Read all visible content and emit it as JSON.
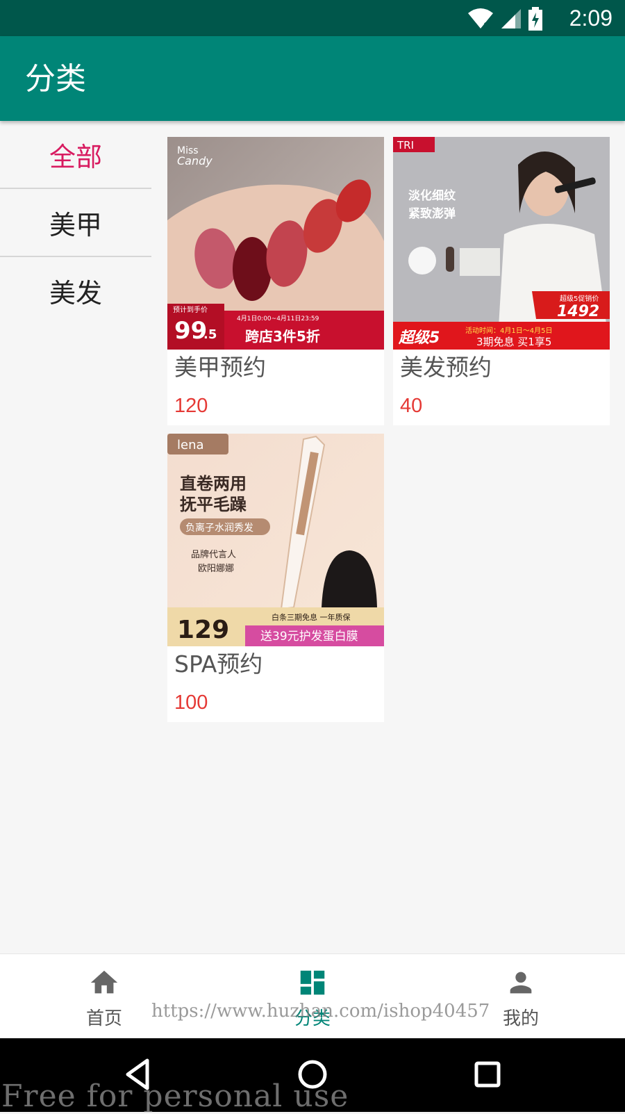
{
  "status_bar": {
    "time": "2:09",
    "icons": [
      "wifi-icon",
      "signal-icon",
      "battery-charging-icon"
    ]
  },
  "app_bar": {
    "title": "分类"
  },
  "side_menu": {
    "items": [
      {
        "label": "全部",
        "active": true
      },
      {
        "label": "美甲",
        "active": false
      },
      {
        "label": "美发",
        "active": false
      }
    ]
  },
  "products": [
    {
      "name": "美甲预约",
      "price": "120",
      "image": {
        "brand_line1": "Miss",
        "brand_line2": "Candy",
        "price_tag": "预计到手价",
        "price_big": "99",
        "price_small": ".5",
        "date_range": "4月1日0:00~4月11日23:59",
        "promo": "跨店3件5折"
      }
    },
    {
      "name": "美发预约",
      "price": "40",
      "image": {
        "brand": "TRI",
        "slogan_line1": "淡化细纹",
        "slogan_line2": "紧致澎弹",
        "promo_label": "超级5促销价",
        "promo_price": "1492",
        "event": "超级5",
        "event_time": "活动时间：4月1日～4月5日",
        "offer": "3期免息 买1享5"
      }
    },
    {
      "name": "SPA预约",
      "price": "100",
      "image": {
        "brand": "lena",
        "headline_line1": "直卷两用",
        "headline_line2": "抚平毛躁",
        "tag": "负离子水润秀发",
        "endorse_line1": "品牌代言人",
        "endorse_line2": "欧阳娜娜",
        "price": "129",
        "perks": "白条三期免息 一年质保",
        "gift": "送39元护发蛋白膜"
      }
    }
  ],
  "bottom_nav": {
    "items": [
      {
        "label": "首页",
        "icon": "home-icon",
        "active": false
      },
      {
        "label": "分类",
        "icon": "dashboard-icon",
        "active": true
      },
      {
        "label": "我的",
        "icon": "person-icon",
        "active": false
      }
    ]
  },
  "watermarks": {
    "url": "https://www.huzhan.com/ishop40457",
    "free": "Free for personal use"
  },
  "colors": {
    "primary": "#008577",
    "primary_dark": "#00574b",
    "accent": "#d81b60",
    "price": "#e53935"
  }
}
